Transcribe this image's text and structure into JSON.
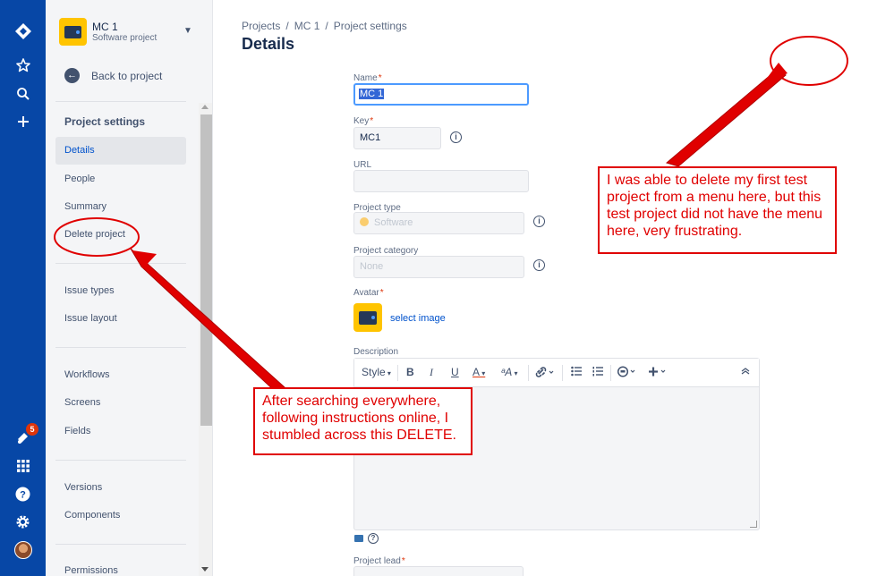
{
  "global_nav": {
    "notification_count": "5"
  },
  "sidebar": {
    "project_name": "MC 1",
    "project_type": "Software project",
    "back_label": "Back to project",
    "section_title": "Project settings",
    "items": [
      {
        "label": "Details",
        "active": true
      },
      {
        "label": "People"
      },
      {
        "label": "Summary"
      },
      {
        "label": "Delete project"
      },
      {
        "label": "Issue types"
      },
      {
        "label": "Issue layout"
      },
      {
        "label": "Workflows"
      },
      {
        "label": "Screens"
      },
      {
        "label": "Fields"
      },
      {
        "label": "Versions"
      },
      {
        "label": "Components"
      },
      {
        "label": "Permissions"
      }
    ]
  },
  "breadcrumbs": [
    "Projects",
    "/",
    "MC 1",
    "/",
    "Project settings"
  ],
  "page_title": "Details",
  "form": {
    "name_label": "Name",
    "name_value": "MC 1",
    "key_label": "Key",
    "key_value": "MC1",
    "url_label": "URL",
    "url_value": "",
    "project_type_label": "Project type",
    "project_type_value": "Software",
    "project_category_label": "Project category",
    "project_category_value": "None",
    "avatar_label": "Avatar",
    "select_image": "select image",
    "description_label": "Description",
    "toolbar": {
      "style": "Style",
      "bold": "B",
      "italic": "I",
      "underline": "U",
      "text_color": "A",
      "more_format": "ᵃA"
    },
    "project_lead_label": "Project lead",
    "required_mark": "*"
  },
  "annotations": {
    "callout_1": "After searching everywhere, following instructions online, I stumbled across this DELETE.",
    "callout_2": "I was able to delete my first test project from a menu here, but this test project did not have the menu here, very frustrating.",
    "color": "#e00000"
  }
}
